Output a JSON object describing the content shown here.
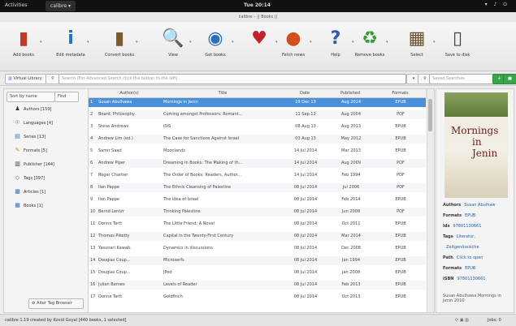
{
  "topbar": {
    "activities": "Activities",
    "app_menu": "calibre ▾",
    "clock": "Tue 20:14",
    "tray": "▾ ♪ ⏻"
  },
  "window_title": "calibre – || Books ||",
  "toolbar": [
    {
      "label": "Add books",
      "icon": "add-books-icon",
      "glyph": "▮",
      "color": "#c0392b"
    },
    {
      "label": "Edit metadata",
      "icon": "info-icon",
      "glyph": "i",
      "color": "#1e6fd0"
    },
    {
      "label": "Convert books",
      "icon": "convert-icon",
      "glyph": "▮",
      "color": "#7a5c2e"
    },
    {
      "label": "View",
      "icon": "magnifier-icon",
      "glyph": "🔍",
      "color": "#555555"
    },
    {
      "label": "Get books",
      "icon": "globe-icon",
      "glyph": "◉",
      "color": "#2a6fb8"
    },
    {
      "label": "",
      "icon": "heart-icon",
      "glyph": "♥",
      "color": "#c0212b"
    },
    {
      "label": "Fetch news",
      "icon": "news-icon",
      "glyph": "●",
      "color": "#d24d1f"
    },
    {
      "label": "Help",
      "icon": "help-icon",
      "glyph": "?",
      "color": "#2f58b0"
    },
    {
      "label": "Remove books",
      "icon": "recycle-icon",
      "glyph": "♻",
      "color": "#3a9a3a"
    },
    {
      "label": "Select",
      "icon": "library-icon",
      "glyph": "▦",
      "color": "#6b4e2a"
    },
    {
      "label": "Save to disk",
      "icon": "save-icon",
      "glyph": "▯",
      "color": "#444444"
    }
  ],
  "search": {
    "virtual_library": "Virtual Library",
    "placeholder": "Search (For Advanced Search click the button to the left)",
    "saved_search": "Saved Searches"
  },
  "tag_browser": {
    "sort_label": "Sort by name",
    "find_label": "Find",
    "items": [
      {
        "label": "Authors [159]",
        "icon": "person-icon",
        "glyph": "♟",
        "color": "#333333"
      },
      {
        "label": "Languages [4]",
        "icon": "language-icon",
        "glyph": "☉",
        "color": "#2a6fb8"
      },
      {
        "label": "Series [13]",
        "icon": "series-icon",
        "glyph": "▤",
        "color": "#2a6fb8"
      },
      {
        "label": "Formats [5]",
        "icon": "formats-icon",
        "glyph": "✎",
        "color": "#d08a1e"
      },
      {
        "label": "Publisher [144]",
        "icon": "publisher-icon",
        "glyph": "▥",
        "color": "#333333"
      },
      {
        "label": "Tags [397]",
        "icon": "tag-icon",
        "glyph": "◇",
        "color": "#555555"
      },
      {
        "label": "Articles [1]",
        "icon": "column-icon",
        "glyph": "▦",
        "color": "#2a6fb8"
      },
      {
        "label": "Books [1]",
        "icon": "column-icon",
        "glyph": "▦",
        "color": "#2a6fb8"
      }
    ],
    "alter_button": "Alter Tag Browser"
  },
  "book_table": {
    "columns": [
      "Author(s)",
      "Title",
      "Date",
      "Published",
      "Formats"
    ],
    "rows": [
      [
        "Susan Abulhawa",
        "Mornings in Jenin",
        "19 Dec 13",
        "Aug 2014",
        "EPUB"
      ],
      [
        "Board, Philosophy",
        "Coming amongst Professors: Romant...",
        "11 Sep 13",
        "Aug 2004",
        "PDF"
      ],
      [
        "Steve Andrews",
        "ISIS",
        "08 Aug 13",
        "Aug 2013",
        "EPUB"
      ],
      [
        "Andrew Lim (ed.)",
        "The Case for Sanctions Against Israel",
        "03 Aug 13",
        "May 2012",
        "EPUB"
      ],
      [
        "Samir Saad",
        "Moonlands",
        "14 Jul 2014",
        "Mar 2013",
        "EPUB"
      ],
      [
        "Andrew Piper",
        "Dreaming in Books: The Making of th...",
        "14 Jul 2014",
        "Aug 2009",
        "PDF"
      ],
      [
        "Roger Chartier",
        "The Order of Books: Readers, Author...",
        "14 Jul 2014",
        "Feb 1994",
        "PDF"
      ],
      [
        "Ilan Pappe",
        "The Ethnic Cleansing of Palestine",
        "08 Jul 2014",
        "Jul 2006",
        "PDF"
      ],
      [
        "Ilan Pappe",
        "The Idea of Israel",
        "08 Jul 2014",
        "Feb 2014",
        "EPUB"
      ],
      [
        "Bernd Lentzr",
        "Thinking Palestine",
        "08 Jul 2014",
        "Jun 2008",
        "PDF"
      ],
      [
        "Donna Tartt",
        "The Little Friend: A Novel",
        "08 Jul 2014",
        "Oct 2011",
        "EPUB"
      ],
      [
        "Thomas Piketty",
        "Capital in the Twenty-First Century",
        "08 Jul 2014",
        "Mar 2014",
        "EPUB"
      ],
      [
        "Yasunari Kawab.",
        "Dynamics in discussions",
        "08 Jul 2014",
        "Dec 2008",
        "EPUB"
      ],
      [
        "Douglas Coup...",
        "Microserfs",
        "08 Jul 2014",
        "Jan 1994",
        "EPUB"
      ],
      [
        "Douglas Coup...",
        "JPod",
        "08 Jul 2014",
        "Jan 2008",
        "EPUB"
      ],
      [
        "Julian Barnes",
        "Levels of Reader",
        "08 Jul 2014",
        "Feb 2013",
        "EPUB"
      ],
      [
        "Donna Tartt",
        "Goldfinch",
        "08 Jul 2014",
        "Oct 2013",
        "EPUB"
      ]
    ]
  },
  "details": {
    "cover_title_1": "Mornings",
    "cover_title_2": "in Jenin",
    "fields": [
      {
        "key": "Authors",
        "value": "Susan Abulhaw"
      },
      {
        "key": "Formats",
        "value": "EPUB"
      },
      {
        "key": "Ids",
        "value": "97801130661"
      },
      {
        "key": "Tags",
        "value": "Literatur,"
      },
      {
        "key": "",
        "value": "Zeitgenössische"
      },
      {
        "key": "Path",
        "value": "Click to open"
      },
      {
        "key": "Formats",
        "value": "EPUB"
      },
      {
        "key": "ISBN",
        "value": "97801130661"
      }
    ],
    "description": "Susan Abulhawa Mornings in Jenin 2010"
  },
  "status": {
    "left": "calibre 1.19 created by Kovid Goyal  [440 books, 1 selected]",
    "jobs": "Jobs: 0"
  }
}
